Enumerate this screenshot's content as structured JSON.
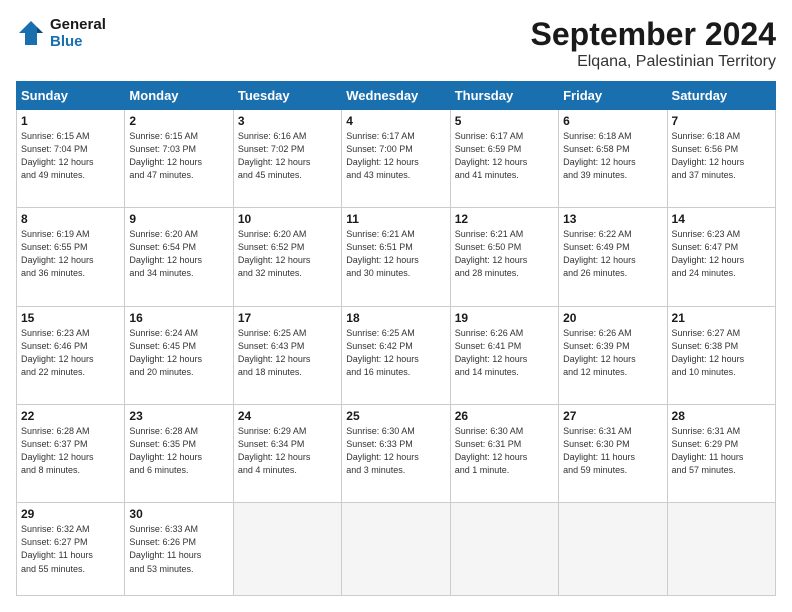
{
  "header": {
    "logo_line1": "General",
    "logo_line2": "Blue",
    "month": "September 2024",
    "location": "Elqana, Palestinian Territory"
  },
  "days_of_week": [
    "Sunday",
    "Monday",
    "Tuesday",
    "Wednesday",
    "Thursday",
    "Friday",
    "Saturday"
  ],
  "weeks": [
    [
      {
        "day": "1",
        "info": "Sunrise: 6:15 AM\nSunset: 7:04 PM\nDaylight: 12 hours\nand 49 minutes."
      },
      {
        "day": "2",
        "info": "Sunrise: 6:15 AM\nSunset: 7:03 PM\nDaylight: 12 hours\nand 47 minutes."
      },
      {
        "day": "3",
        "info": "Sunrise: 6:16 AM\nSunset: 7:02 PM\nDaylight: 12 hours\nand 45 minutes."
      },
      {
        "day": "4",
        "info": "Sunrise: 6:17 AM\nSunset: 7:00 PM\nDaylight: 12 hours\nand 43 minutes."
      },
      {
        "day": "5",
        "info": "Sunrise: 6:17 AM\nSunset: 6:59 PM\nDaylight: 12 hours\nand 41 minutes."
      },
      {
        "day": "6",
        "info": "Sunrise: 6:18 AM\nSunset: 6:58 PM\nDaylight: 12 hours\nand 39 minutes."
      },
      {
        "day": "7",
        "info": "Sunrise: 6:18 AM\nSunset: 6:56 PM\nDaylight: 12 hours\nand 37 minutes."
      }
    ],
    [
      {
        "day": "8",
        "info": "Sunrise: 6:19 AM\nSunset: 6:55 PM\nDaylight: 12 hours\nand 36 minutes."
      },
      {
        "day": "9",
        "info": "Sunrise: 6:20 AM\nSunset: 6:54 PM\nDaylight: 12 hours\nand 34 minutes."
      },
      {
        "day": "10",
        "info": "Sunrise: 6:20 AM\nSunset: 6:52 PM\nDaylight: 12 hours\nand 32 minutes."
      },
      {
        "day": "11",
        "info": "Sunrise: 6:21 AM\nSunset: 6:51 PM\nDaylight: 12 hours\nand 30 minutes."
      },
      {
        "day": "12",
        "info": "Sunrise: 6:21 AM\nSunset: 6:50 PM\nDaylight: 12 hours\nand 28 minutes."
      },
      {
        "day": "13",
        "info": "Sunrise: 6:22 AM\nSunset: 6:49 PM\nDaylight: 12 hours\nand 26 minutes."
      },
      {
        "day": "14",
        "info": "Sunrise: 6:23 AM\nSunset: 6:47 PM\nDaylight: 12 hours\nand 24 minutes."
      }
    ],
    [
      {
        "day": "15",
        "info": "Sunrise: 6:23 AM\nSunset: 6:46 PM\nDaylight: 12 hours\nand 22 minutes."
      },
      {
        "day": "16",
        "info": "Sunrise: 6:24 AM\nSunset: 6:45 PM\nDaylight: 12 hours\nand 20 minutes."
      },
      {
        "day": "17",
        "info": "Sunrise: 6:25 AM\nSunset: 6:43 PM\nDaylight: 12 hours\nand 18 minutes."
      },
      {
        "day": "18",
        "info": "Sunrise: 6:25 AM\nSunset: 6:42 PM\nDaylight: 12 hours\nand 16 minutes."
      },
      {
        "day": "19",
        "info": "Sunrise: 6:26 AM\nSunset: 6:41 PM\nDaylight: 12 hours\nand 14 minutes."
      },
      {
        "day": "20",
        "info": "Sunrise: 6:26 AM\nSunset: 6:39 PM\nDaylight: 12 hours\nand 12 minutes."
      },
      {
        "day": "21",
        "info": "Sunrise: 6:27 AM\nSunset: 6:38 PM\nDaylight: 12 hours\nand 10 minutes."
      }
    ],
    [
      {
        "day": "22",
        "info": "Sunrise: 6:28 AM\nSunset: 6:37 PM\nDaylight: 12 hours\nand 8 minutes."
      },
      {
        "day": "23",
        "info": "Sunrise: 6:28 AM\nSunset: 6:35 PM\nDaylight: 12 hours\nand 6 minutes."
      },
      {
        "day": "24",
        "info": "Sunrise: 6:29 AM\nSunset: 6:34 PM\nDaylight: 12 hours\nand 4 minutes."
      },
      {
        "day": "25",
        "info": "Sunrise: 6:30 AM\nSunset: 6:33 PM\nDaylight: 12 hours\nand 3 minutes."
      },
      {
        "day": "26",
        "info": "Sunrise: 6:30 AM\nSunset: 6:31 PM\nDaylight: 12 hours\nand 1 minute."
      },
      {
        "day": "27",
        "info": "Sunrise: 6:31 AM\nSunset: 6:30 PM\nDaylight: 11 hours\nand 59 minutes."
      },
      {
        "day": "28",
        "info": "Sunrise: 6:31 AM\nSunset: 6:29 PM\nDaylight: 11 hours\nand 57 minutes."
      }
    ],
    [
      {
        "day": "29",
        "info": "Sunrise: 6:32 AM\nSunset: 6:27 PM\nDaylight: 11 hours\nand 55 minutes."
      },
      {
        "day": "30",
        "info": "Sunrise: 6:33 AM\nSunset: 6:26 PM\nDaylight: 11 hours\nand 53 minutes."
      },
      {
        "day": "",
        "info": ""
      },
      {
        "day": "",
        "info": ""
      },
      {
        "day": "",
        "info": ""
      },
      {
        "day": "",
        "info": ""
      },
      {
        "day": "",
        "info": ""
      }
    ]
  ]
}
